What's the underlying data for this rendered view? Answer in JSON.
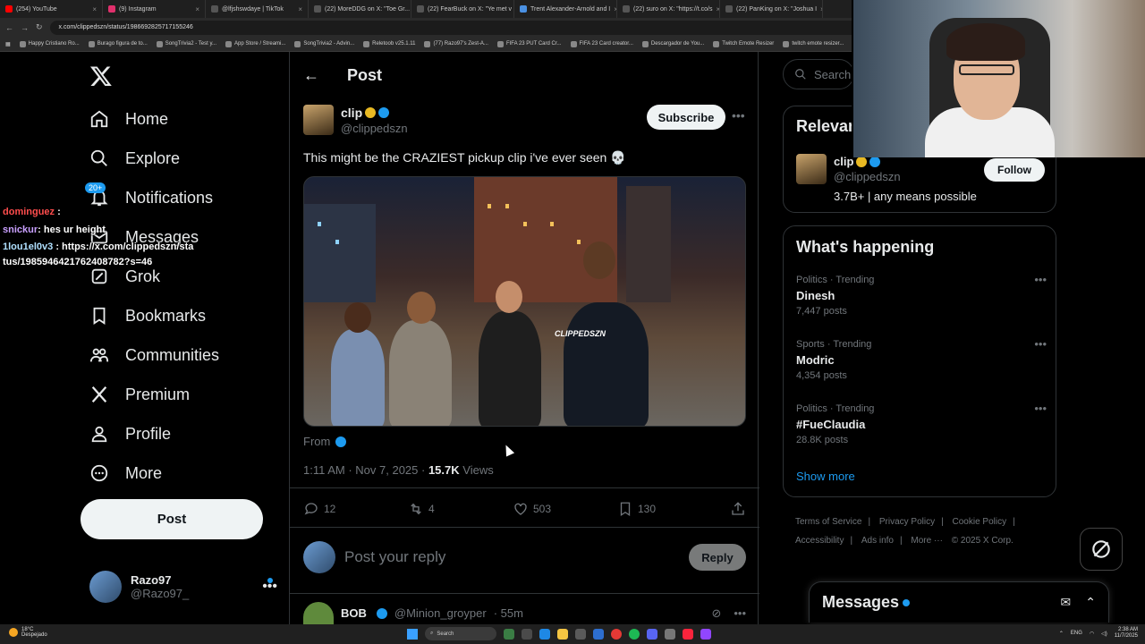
{
  "browser": {
    "tabs": [
      {
        "label": "(254) YouTube",
        "color": "#ff0000"
      },
      {
        "label": "(9) Instagram",
        "color": "#e1306c"
      },
      {
        "label": "@lfjshswdaye | TikTok",
        "color": "#111111"
      },
      {
        "label": "(22) MoreDDG on X: \"Toe Gr...",
        "color": "#111111"
      },
      {
        "label": "(22) FearBuck on X: \"Ye met v",
        "color": "#111111"
      },
      {
        "label": "Trent Alexander-Arnold and I",
        "color": "#4a90e2"
      },
      {
        "label": "(22) suro on X: \"https://t.co/s",
        "color": "#111111"
      },
      {
        "label": "(22) PanKing on X: \"Joshua I",
        "color": "#111111"
      }
    ],
    "url": "x.com/clippedszn/status/1986692825717155246",
    "bookmarks": [
      "Happy Cristiano Ro...",
      "Burago figura de to...",
      "SongTrivia2 - Test y...",
      "App Store / Streami...",
      "SongTrivia2 - Advin...",
      "Reletoob v25.1.11",
      "(77) Razo97's Zest-A...",
      "FIFA 23 PUT Card Cr...",
      "FIFA 23 Card creator...",
      "Descargador de You...",
      "Twitch Emote Resizer",
      "twitch emote resizer..."
    ]
  },
  "nav": {
    "items": [
      {
        "label": "Home",
        "icon": "home-icon"
      },
      {
        "label": "Explore",
        "icon": "search-icon"
      },
      {
        "label": "Notifications",
        "icon": "bell-icon"
      },
      {
        "label": "Messages",
        "icon": "mail-icon"
      },
      {
        "label": "Grok",
        "icon": "grok-icon"
      },
      {
        "label": "Bookmarks",
        "icon": "bookmark-icon"
      },
      {
        "label": "Communities",
        "icon": "communities-icon"
      },
      {
        "label": "Premium",
        "icon": "x-icon"
      },
      {
        "label": "Profile",
        "icon": "person-icon"
      },
      {
        "label": "More",
        "icon": "more-circle-icon"
      }
    ],
    "notification_badge": "20+",
    "post_button": "Post",
    "account": {
      "name": "Razo97",
      "handle": "@Razo97_"
    }
  },
  "chat": [
    {
      "user": "dominguez",
      "text": ":"
    },
    {
      "user": "snickur",
      "text": ": hes ur height"
    },
    {
      "user": "1lou1el0v3",
      "text": ": https://x.com/clippedszn/status/1985946421762408782?s=46"
    }
  ],
  "post": {
    "header_title": "Post",
    "author_name": "clip",
    "author_handle": "@clippedszn",
    "subscribe_label": "Subscribe",
    "text": "This might be the CRAZIEST pickup clip i've ever seen 💀",
    "media_watermark": "CLIPPEDSZN",
    "from_label": "From",
    "time": "1:11 AM · Nov 7, 2025 · ",
    "views_count": "15.7K",
    "views_label": " Views",
    "replies": "12",
    "reposts": "4",
    "likes": "503",
    "bookmarks": "130",
    "reply_placeholder": "Post your reply",
    "reply_button": "Reply"
  },
  "first_reply": {
    "name": "BOB",
    "handle": "@Minion_groyper",
    "time": "· 55m"
  },
  "right": {
    "search_placeholder": "Search",
    "relevant_title": "Relevant",
    "relevant_name": "clip",
    "relevant_handle": "@clippedszn",
    "relevant_bio": "3.7B+ | any means possible",
    "follow_label": "Follow",
    "happening_title": "What's happening",
    "trends": [
      {
        "category": "Politics · Trending",
        "topic": "Dinesh",
        "count": "7,447 posts"
      },
      {
        "category": "Sports · Trending",
        "topic": "Modric",
        "count": "4,354 posts"
      },
      {
        "category": "Politics · Trending",
        "topic": "#FueClaudia",
        "count": "28.8K posts"
      }
    ],
    "show_more": "Show more",
    "footer": [
      "Terms of Service",
      "Privacy Policy",
      "Cookie Policy",
      "Accessibility",
      "Ads info",
      "More ···",
      "© 2025 X Corp."
    ],
    "messages_title": "Messages"
  },
  "taskbar": {
    "weather_temp": "18°C",
    "weather_desc": "Despejado",
    "search_label": "Search",
    "lang": "ENG",
    "time": "2:38 AM",
    "date": "11/7/2025"
  },
  "colors": {
    "accent": "#1d9bf0",
    "background": "#000000",
    "verified_gold": "#e8b923"
  }
}
